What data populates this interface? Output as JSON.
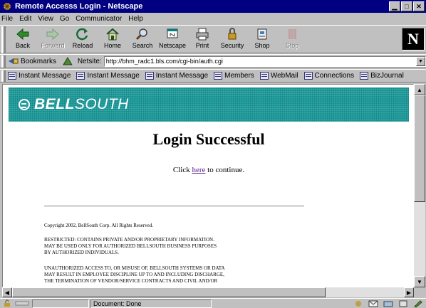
{
  "window": {
    "title": "Remote Accesss Login - Netscape"
  },
  "menu": [
    {
      "label": "File"
    },
    {
      "label": "Edit"
    },
    {
      "label": "View"
    },
    {
      "label": "Go"
    },
    {
      "label": "Communicator"
    },
    {
      "label": "Help"
    }
  ],
  "toolbar": [
    {
      "label": "Back",
      "icon": "back-arrow-icon",
      "enabled": true
    },
    {
      "label": "Forward",
      "icon": "forward-arrow-icon",
      "enabled": false
    },
    {
      "label": "Reload",
      "icon": "reload-icon",
      "enabled": true
    },
    {
      "label": "Home",
      "icon": "home-icon",
      "enabled": true
    },
    {
      "label": "Search",
      "icon": "search-icon",
      "enabled": true
    },
    {
      "label": "Netscape",
      "icon": "netscape-icon",
      "enabled": true
    },
    {
      "label": "Print",
      "icon": "print-icon",
      "enabled": true
    },
    {
      "label": "Security",
      "icon": "lock-icon",
      "enabled": true
    },
    {
      "label": "Shop",
      "icon": "shop-icon",
      "enabled": true
    },
    {
      "label": "Stop",
      "icon": "stop-icon",
      "enabled": false
    }
  ],
  "location": {
    "bookmarks_label": "Bookmarks",
    "netsite_label": "Netsite:",
    "url": "http://bhm_radc1.bls.com/cgi-bin/auth.cgi"
  },
  "personal_toolbar": [
    {
      "label": "Instant Message"
    },
    {
      "label": "Instant Message"
    },
    {
      "label": "Instant Message"
    },
    {
      "label": "Members"
    },
    {
      "label": "WebMail"
    },
    {
      "label": "Connections"
    },
    {
      "label": "BizJournal"
    }
  ],
  "page": {
    "brand": {
      "bold": "BELL",
      "light": "SOUTH"
    },
    "heading": "Login Successful",
    "continue": {
      "before": "Click ",
      "link": "here",
      "after": " to continue."
    },
    "copyright": "Copyright 2002, BellSouth Corp. All Rights Reserved.",
    "restricted": [
      "RESTRICTED: CONTAINS PRIVATE AND/OR PROPRIETARY INFORMATION.",
      "MAY BE USED ONLY FOR AUTHORIZED BELLSOUTH BUSINESS PURPOSES",
      "BY AUTHORIZED INDIVIDUALS."
    ],
    "unauthorized": [
      "UNAUTHORIZED ACCESS TO, OR MISUSE OF, BELLSOUTH SYSTEMS OR DATA",
      "MAY RESULT IN EMPLOYEE DISCIPLINE UP TO AND INCLUDING DISCHARGE,",
      "THE TERMINATION OF VENDOR/SERVICE CONTRACTS AND CIVIL AND/OR"
    ]
  },
  "status": {
    "text": "Document: Done"
  },
  "colors": {
    "banner": "#1d9a9a",
    "titlebar": "#000080",
    "link": "#551a8b"
  }
}
